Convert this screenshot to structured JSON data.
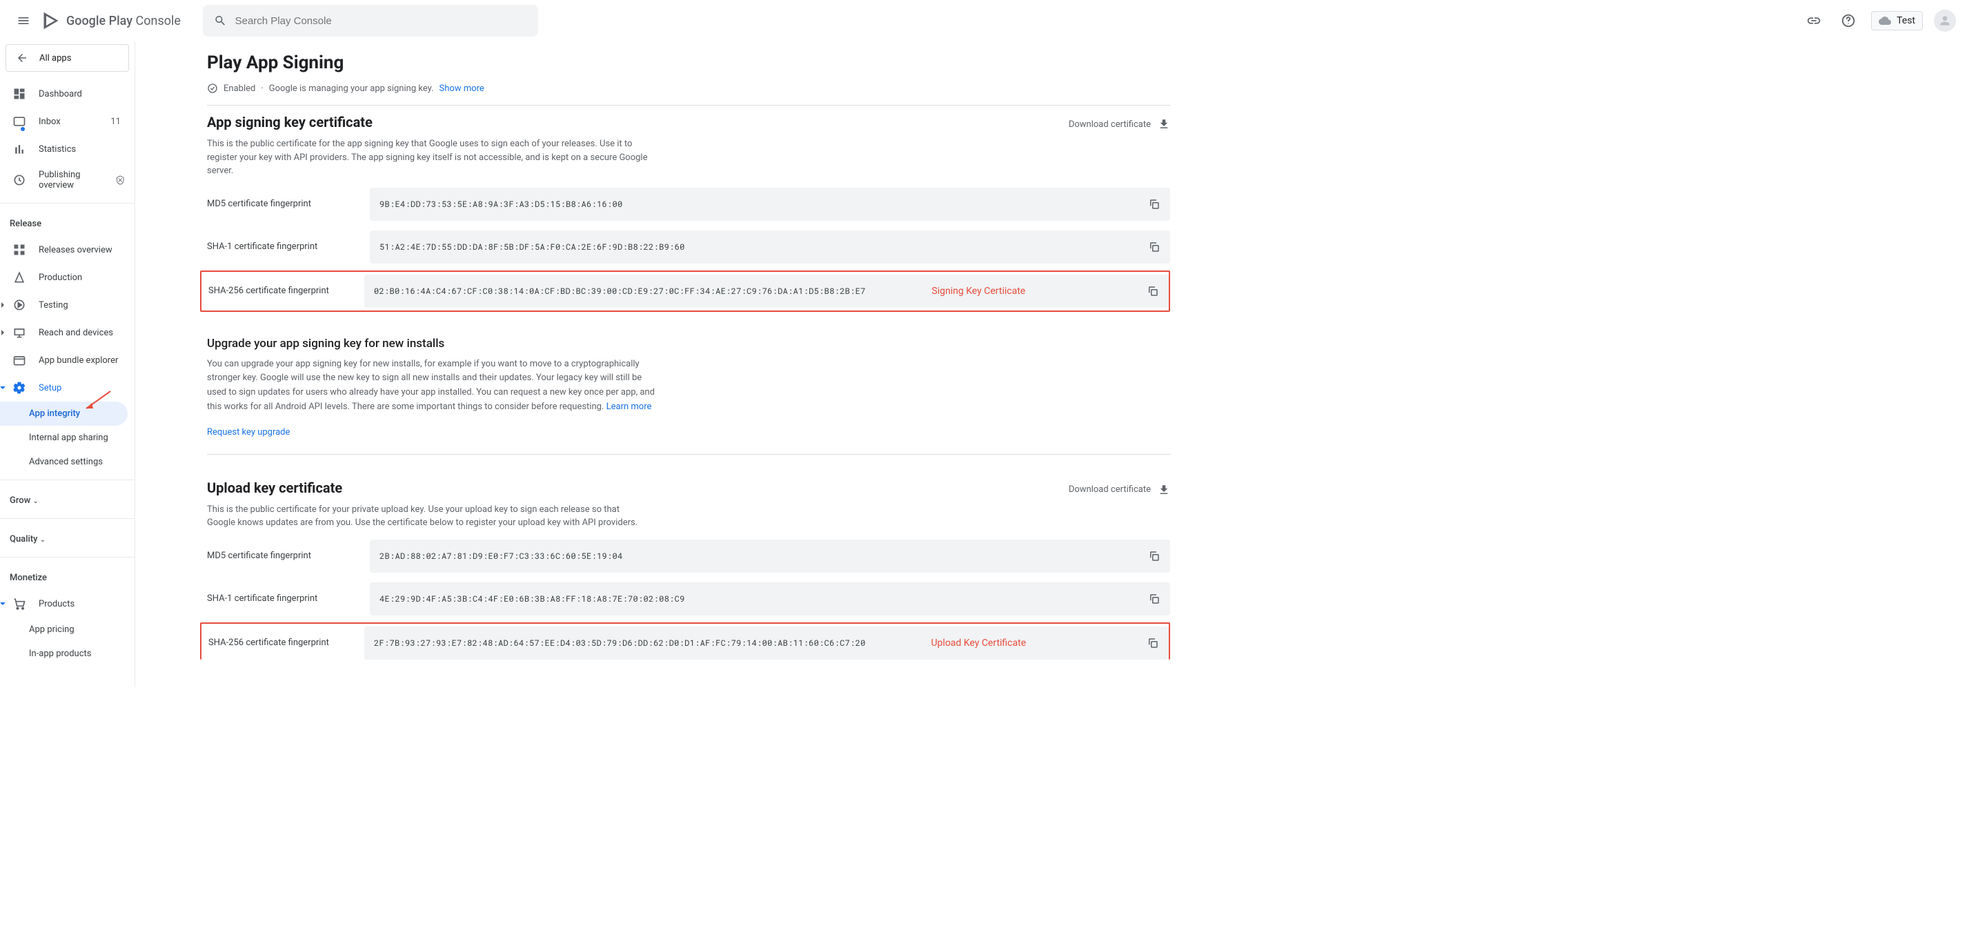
{
  "header": {
    "logo_text_1": "Google Play",
    "logo_text_2": "Console",
    "search_placeholder": "Search Play Console",
    "test_label": "Test"
  },
  "sidebar": {
    "all_apps": "All apps",
    "items": {
      "dashboard": "Dashboard",
      "inbox": "Inbox",
      "inbox_badge": "11",
      "statistics": "Statistics",
      "publishing": "Publishing overview"
    },
    "release": {
      "title": "Release",
      "releases_overview": "Releases overview",
      "production": "Production",
      "testing": "Testing",
      "reach": "Reach and devices",
      "bundle": "App bundle explorer",
      "setup": "Setup",
      "setup_items": {
        "app_integrity": "App integrity",
        "internal_sharing": "Internal app sharing",
        "advanced": "Advanced settings"
      }
    },
    "grow": "Grow",
    "quality": "Quality",
    "monetize": {
      "title": "Monetize",
      "products": "Products",
      "app_pricing": "App pricing",
      "in_app": "In-app products"
    }
  },
  "main": {
    "title": "Play App Signing",
    "status_enabled": "Enabled",
    "status_desc": "Google is managing your app signing key.",
    "show_more": "Show more",
    "section1": {
      "title": "App signing key certificate",
      "desc": "This is the public certificate for the app signing key that Google uses to sign each of your releases. Use it to register your key with API providers. The app signing key itself is not accessible, and is kept on a secure Google server.",
      "download": "Download certificate",
      "md5_label": "MD5 certificate fingerprint",
      "md5_value": "9B:E4:DD:73:53:5E:A8:9A:3F:A3:D5:15:B8:A6:16:00",
      "sha1_label": "SHA-1 certificate fingerprint",
      "sha1_value": "51:A2:4E:7D:55:DD:DA:8F:5B:DF:5A:F0:CA:2E:6F:9D:B8:22:B9:60",
      "sha256_label": "SHA-256 certificate fingerprint",
      "sha256_value": "02:B0:16:4A:C4:67:CF:C0:38:14:0A:CF:BD:BC:39:00:CD:E9:27:0C:FF:34:AE:27:C9:76:DA:A1:D5:B8:2B:E7",
      "annotation": "Signing Key Certiicate"
    },
    "upgrade": {
      "title": "Upgrade your app signing key for new installs",
      "desc": "You can upgrade your app signing key for new installs, for example if you want to move to a cryptographically stronger key. Google will use the new key to sign all new installs and their updates. Your legacy key will still be used to sign updates for users who already have your app installed. You can request a new key once per app, and this works for all Android API levels. There are some important things to consider before requesting.",
      "learn_more": "Learn more",
      "request": "Request key upgrade"
    },
    "section2": {
      "title": "Upload key certificate",
      "desc": "This is the public certificate for your private upload key. Use your upload key to sign each release so that Google knows updates are from you. Use the certificate below to register your upload key with API providers.",
      "download": "Download certificate",
      "md5_label": "MD5 certificate fingerprint",
      "md5_value": "2B:AD:88:02:A7:81:D9:E0:F7:C3:33:6C:60:5E:19:04",
      "sha1_label": "SHA-1 certificate fingerprint",
      "sha1_value": "4E:29:9D:4F:A5:3B:C4:4F:E0:6B:3B:A8:FF:18:A8:7E:70:02:08:C9",
      "sha256_label": "SHA-256 certificate fingerprint",
      "sha256_value": "2F:7B:93:27:93:E7:82:48:AD:64:57:EE:D4:03:5D:79:D6:DD:62:D0:D1:AF:FC:79:14:00:AB:11:60:C6:C7:20",
      "annotation": "Upload Key Certificate"
    }
  }
}
